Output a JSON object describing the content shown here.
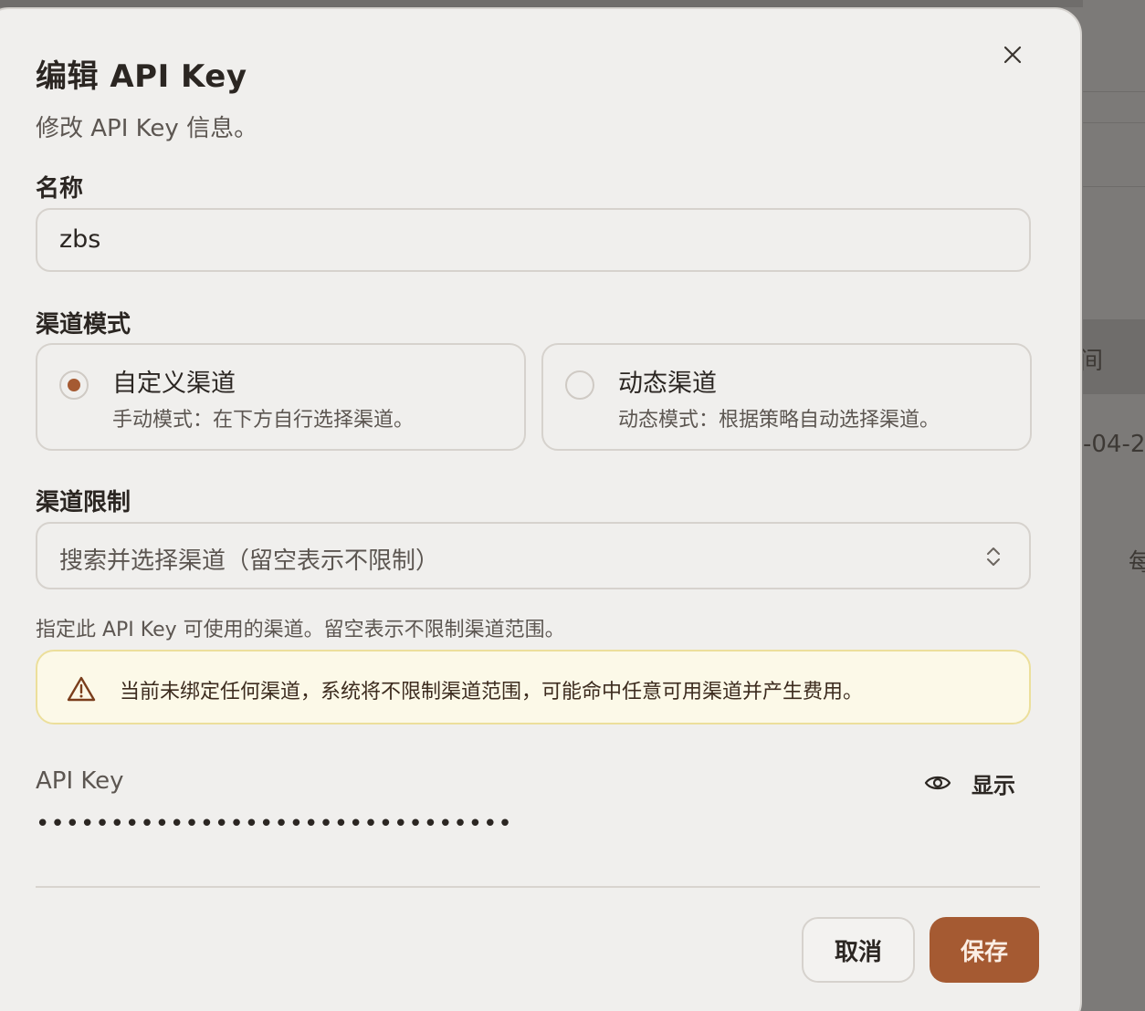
{
  "background": {
    "fragments": [
      "间",
      "-04-2",
      "每"
    ]
  },
  "dialog": {
    "title": "编辑 API Key",
    "subtitle": "修改 API Key 信息。",
    "close_icon": "close-icon"
  },
  "name_field": {
    "label": "名称",
    "value": "zbs"
  },
  "channel_mode": {
    "label": "渠道模式",
    "options": [
      {
        "title": "自定义渠道",
        "description": "手动模式：在下方自行选择渠道。",
        "selected": true
      },
      {
        "title": "动态渠道",
        "description": "动态模式：根据策略自动选择渠道。",
        "selected": false
      }
    ]
  },
  "channel_limit": {
    "label": "渠道限制",
    "placeholder": "搜索并选择渠道（留空表示不限制）",
    "helper": "指定此 API Key 可使用的渠道。留空表示不限制渠道范围。",
    "chevron_icon": "chevron-up-down-icon"
  },
  "warning": {
    "icon": "warning-triangle-icon",
    "text": "当前未绑定任何渠道，系统将不限制渠道范围，可能命中任意可用渠道并产生费用。"
  },
  "api_key": {
    "label": "API Key",
    "show_label": "显示",
    "show_icon": "eye-icon",
    "masked_value": "••••••••••••••••••••••••••••••••"
  },
  "footer": {
    "cancel_label": "取消",
    "save_label": "保存"
  },
  "colors": {
    "accent": "#a55a32",
    "modal_bg": "#f0efed",
    "warning_bg": "#fcf9e8",
    "warning_border": "#ecdf9b"
  }
}
